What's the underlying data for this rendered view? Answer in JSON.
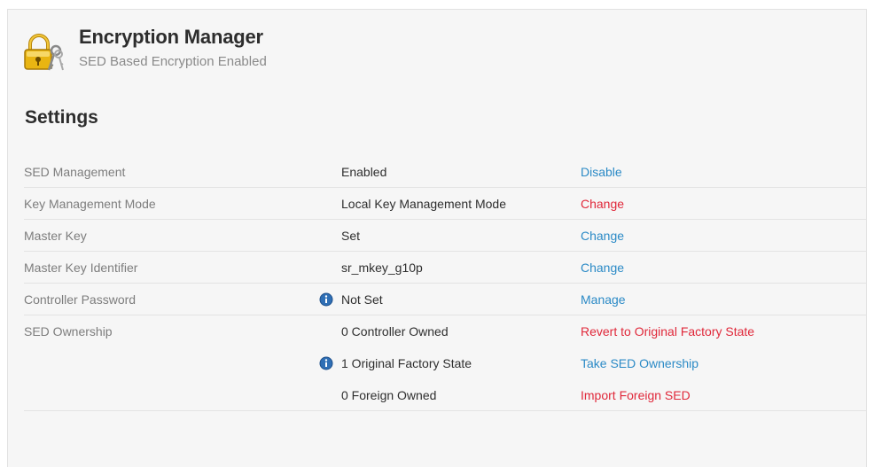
{
  "header": {
    "title": "Encryption Manager",
    "subtitle": "SED Based Encryption Enabled",
    "icon": "lock-keys-icon"
  },
  "settings": {
    "heading": "Settings",
    "rows": [
      {
        "label": "SED Management",
        "value": "Enabled",
        "action": "Disable",
        "action_color": "#2b8ac6"
      },
      {
        "label": "Key Management Mode",
        "value": "Local Key Management Mode",
        "action": "Change",
        "action_color": "#e0283a"
      },
      {
        "label": "Master Key",
        "value": "Set",
        "action": "Change",
        "action_color": "#2b8ac6"
      },
      {
        "label": "Master Key Identifier",
        "value": "sr_mkey_g10p",
        "action": "Change",
        "action_color": "#2b8ac6"
      },
      {
        "label": "Controller Password",
        "value": "Not Set",
        "action": "Manage",
        "action_color": "#2b8ac6",
        "info_icon": true
      },
      {
        "label": "SED Ownership",
        "value": "0 Controller Owned",
        "action": "Revert to Original Factory State",
        "action_color": "#e0283a"
      },
      {
        "label": "",
        "value": "1 Original Factory State",
        "action": "Take SED Ownership",
        "action_color": "#2b8ac6",
        "info_icon": true
      },
      {
        "label": "",
        "value": "0 Foreign Owned",
        "action": "Import Foreign SED",
        "action_color": "#e0283a"
      }
    ]
  },
  "colors": {
    "link_blue": "#2b8ac6",
    "link_red": "#e0283a",
    "panel_background": "#f6f6f6"
  }
}
